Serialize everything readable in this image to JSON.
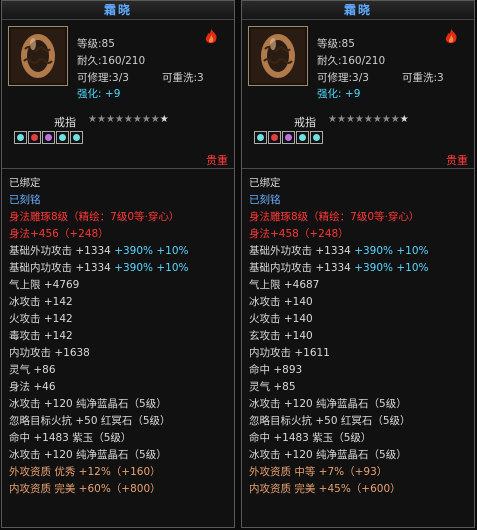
{
  "colors": {
    "title": "#5fa8ff",
    "red": "#ff3434",
    "cyan": "#5ad6ff",
    "blue": "#6ab0ff",
    "orange": "#e8a070"
  },
  "panels": [
    {
      "title": "霜晓",
      "level": "等级:85",
      "durability": "耐久:160/210",
      "repair": "可修理:3/3",
      "rewash": "可重洗:3",
      "enhance_label": "强化:",
      "enhance_value": "+9",
      "type": "戒指",
      "stars_filled": 8,
      "stars_total": 9,
      "gems": [
        "cyan",
        "red",
        "purple",
        "cyan",
        "cyan"
      ],
      "weight_label": "贵重",
      "bound": "已绑定",
      "engraved": "已刻铭",
      "forge": "身法雕琢8级（精绘：7级0等·穿心）",
      "body_bonus": "身法+456（+248）",
      "ext_atk": {
        "base": "基础外功攻击 +1334",
        "pct": "+390% +10%"
      },
      "int_atk": {
        "base": "基础内功攻击 +1334",
        "pct": "+390% +10%"
      },
      "stats": [
        {
          "text": "气上限 +4769",
          "color": "white"
        },
        {
          "text": "冰攻击 +142",
          "color": "white"
        },
        {
          "text": "火攻击 +142",
          "color": "white"
        },
        {
          "text": "毒攻击 +142",
          "color": "white"
        },
        {
          "text": "内功攻击 +1638",
          "color": "white"
        },
        {
          "text": "灵气 +86",
          "color": "white"
        },
        {
          "text": "身法 +46",
          "color": "white"
        },
        {
          "text": "冰攻击 +120 纯净蓝晶石（5级）",
          "color": "white"
        },
        {
          "text": "忽略目标火抗 +50 红冥石（5级）",
          "color": "white"
        },
        {
          "text": "命中 +1483 紫玉（5级）",
          "color": "white"
        },
        {
          "text": "冰攻击 +120 纯净蓝晶石（5级）",
          "color": "white"
        },
        {
          "text": "外攻资质   优秀 +12%（+160）",
          "color": "orange"
        },
        {
          "text": "内攻资质   完美 +60%（+800）",
          "color": "orange"
        }
      ]
    },
    {
      "title": "霜晓",
      "level": "等级:85",
      "durability": "耐久:160/210",
      "repair": "可修理:3/3",
      "rewash": "可重洗:3",
      "enhance_label": "强化:",
      "enhance_value": "+9",
      "type": "戒指",
      "stars_filled": 8,
      "stars_total": 9,
      "gems": [
        "cyan",
        "red",
        "purple",
        "cyan",
        "cyan"
      ],
      "weight_label": "贵重",
      "bound": "已绑定",
      "engraved": "已刻铭",
      "forge": "身法雕琢8级（精绘：7级0等·穿心）",
      "body_bonus": "身法+458（+248）",
      "ext_atk": {
        "base": "基础外功攻击 +1334",
        "pct": "+390% +10%"
      },
      "int_atk": {
        "base": "基础内功攻击 +1334",
        "pct": "+390% +10%"
      },
      "stats": [
        {
          "text": "气上限 +4687",
          "color": "white"
        },
        {
          "text": "冰攻击 +140",
          "color": "white"
        },
        {
          "text": "火攻击 +140",
          "color": "white"
        },
        {
          "text": "玄攻击 +140",
          "color": "white"
        },
        {
          "text": "内功攻击 +1611",
          "color": "white"
        },
        {
          "text": "命中 +893",
          "color": "white"
        },
        {
          "text": "灵气 +85",
          "color": "white"
        },
        {
          "text": "冰攻击 +120 纯净蓝晶石（5级）",
          "color": "white"
        },
        {
          "text": "忽略目标火抗 +50 红冥石（5级）",
          "color": "white"
        },
        {
          "text": "命中 +1483 紫玉（5级）",
          "color": "white"
        },
        {
          "text": "冰攻击 +120 纯净蓝晶石（5级）",
          "color": "white"
        },
        {
          "text": "外攻资质   中等 +7%（+93）",
          "color": "orange"
        },
        {
          "text": "内攻资质   完美 +45%（+600）",
          "color": "orange"
        }
      ]
    }
  ]
}
